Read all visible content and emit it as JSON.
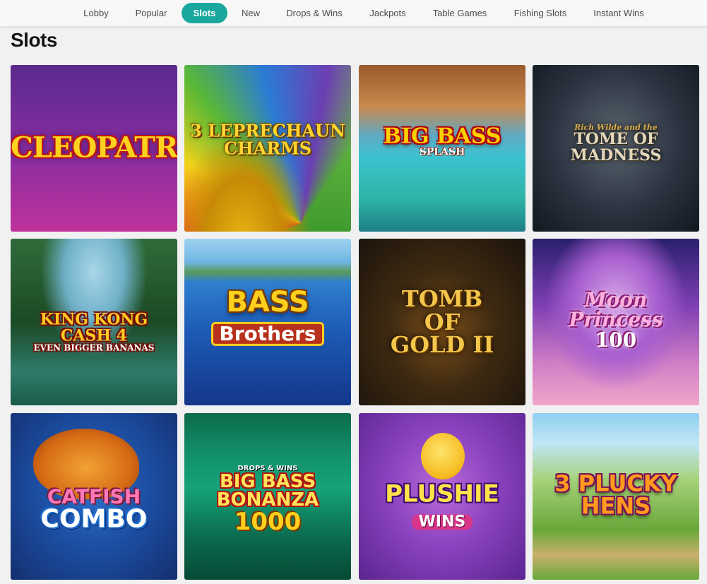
{
  "nav": {
    "tabs": [
      {
        "label": "Lobby"
      },
      {
        "label": "Popular"
      },
      {
        "label": "Slots",
        "active": true
      },
      {
        "label": "New"
      },
      {
        "label": "Drops & Wins"
      },
      {
        "label": "Jackpots"
      },
      {
        "label": "Table Games"
      },
      {
        "label": "Fishing Slots"
      },
      {
        "label": "Instant Wins"
      }
    ],
    "active_color": "#1aa89e"
  },
  "page": {
    "title": "Slots"
  },
  "games": [
    {
      "logo": [
        "CLEOPATRA"
      ]
    },
    {
      "logo": [
        "3 LEPRECHAUN",
        "CHARMS"
      ]
    },
    {
      "logo": [
        "BIG BASS",
        "SPLASH"
      ]
    },
    {
      "logo": [
        "Rich Wilde and the",
        "TOME OF",
        "MADNESS"
      ]
    },
    {
      "logo": [
        "KING KONG",
        "CASH 4",
        "EVEN BIGGER BANANAS"
      ]
    },
    {
      "logo": [
        "BASS",
        "Brothers"
      ]
    },
    {
      "logo": [
        "TOMB",
        "OF",
        "GOLD II"
      ]
    },
    {
      "logo": [
        "Moon",
        "Princess",
        "100"
      ]
    },
    {
      "logo": [
        "CATFISH",
        "COMBO"
      ]
    },
    {
      "logo": [
        "DROPS & WINS",
        "BIG BASS BONANZA",
        "1000"
      ]
    },
    {
      "logo": [
        "PLUSHIE",
        "WINS"
      ]
    },
    {
      "logo": [
        "3 PLUCKY",
        "HENS"
      ]
    }
  ]
}
